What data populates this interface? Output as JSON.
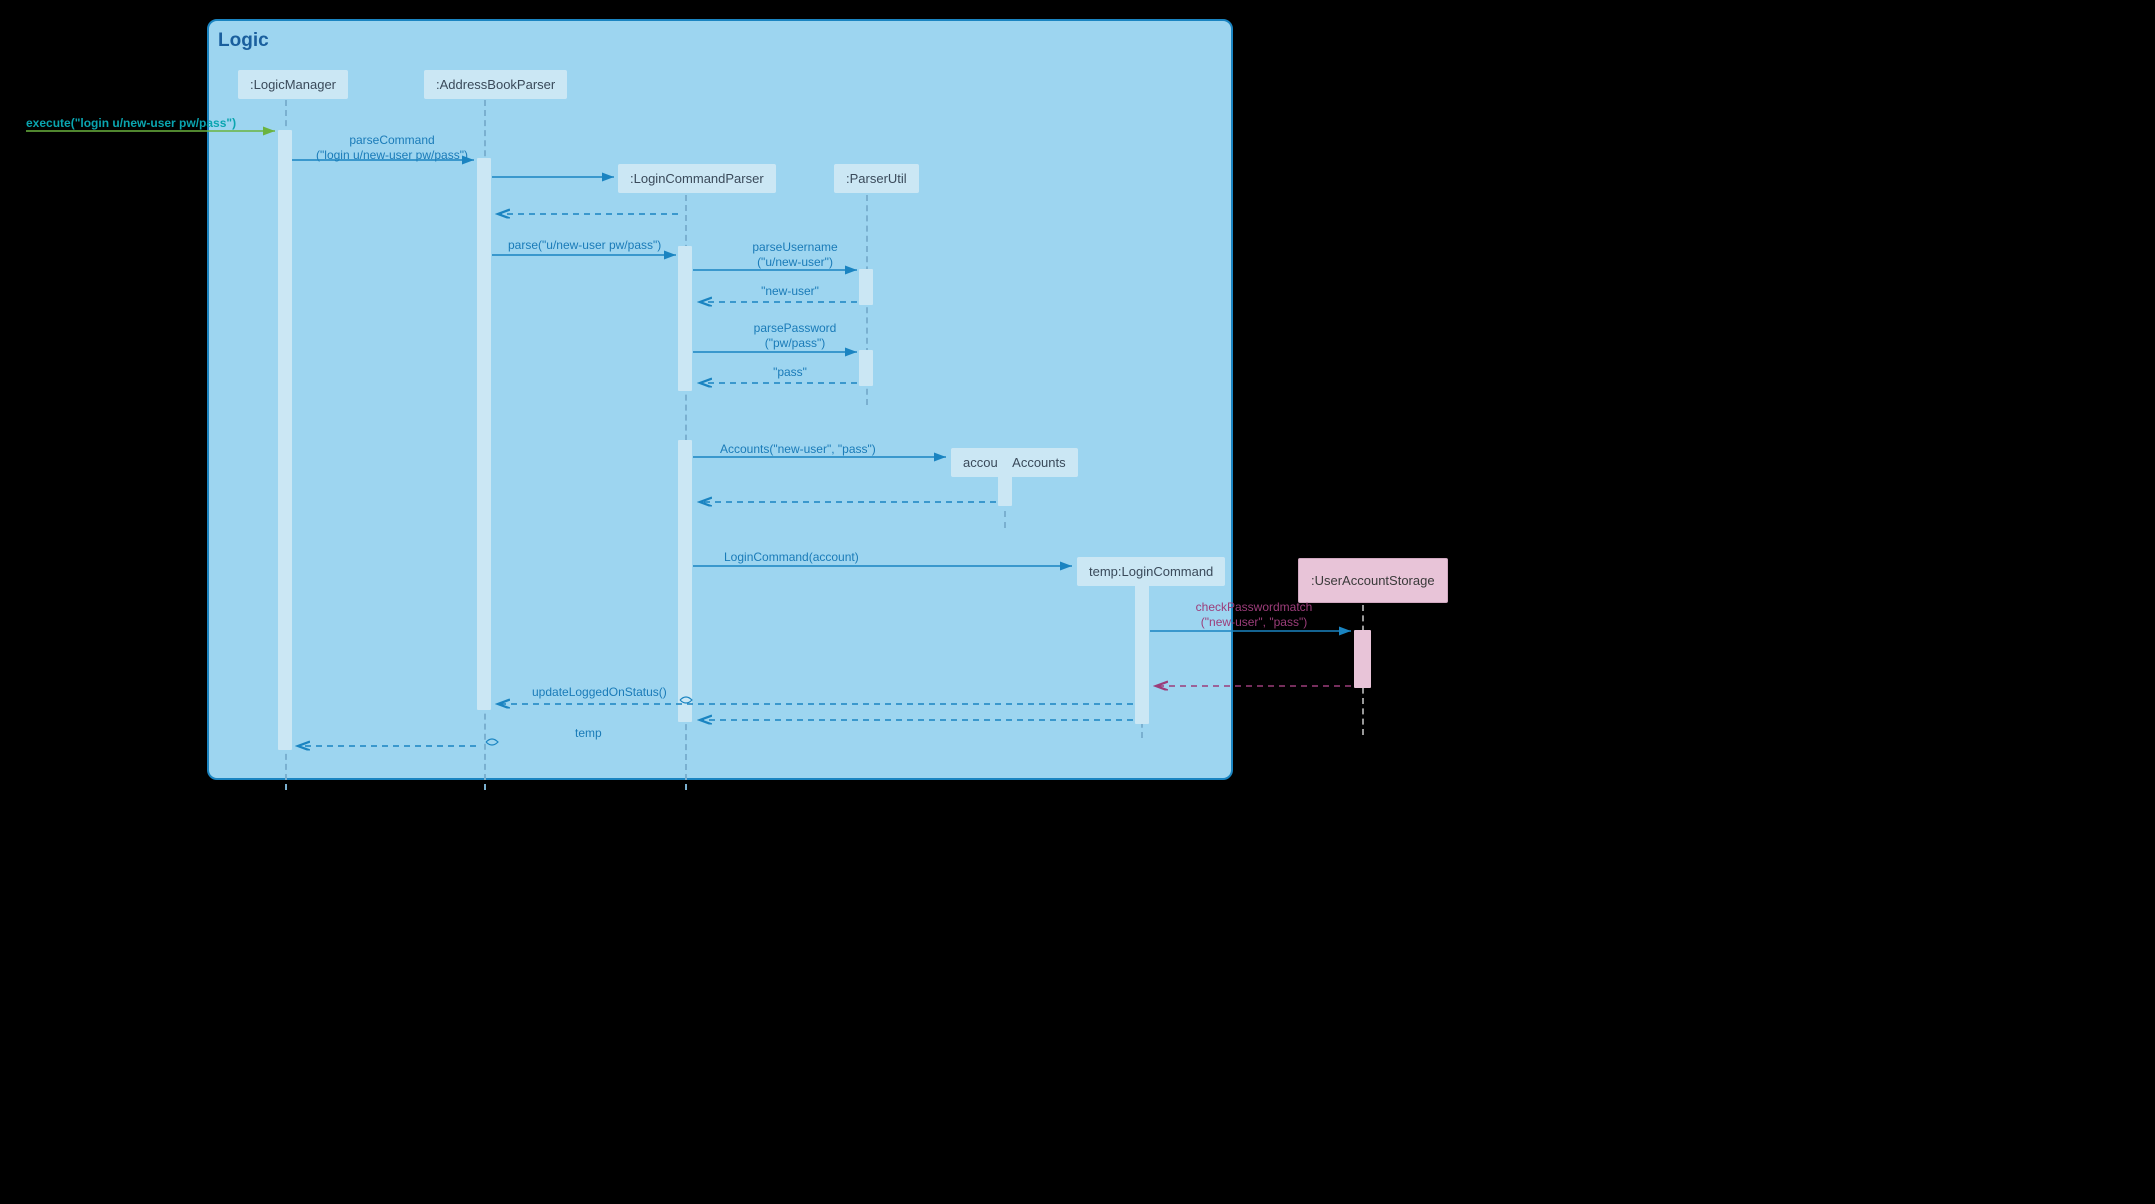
{
  "title": "Logic",
  "lifelines": {
    "logicManager": ":LogicManager",
    "addressBookParser": ":AddressBookParser",
    "loginCommandParser": ":LoginCommandParser",
    "parserUtil": ":ParserUtil",
    "accounts": "account:Accounts",
    "loginCommand": "temp:LoginCommand",
    "userAccountStorage": ":UserAccountStorage"
  },
  "messages": {
    "execute": "execute(\"login u/new-user pw/pass\")",
    "parseCommandLabel": "parseCommand",
    "parseCommandArg": "(\"login u/new-user pw/pass\")",
    "parse": "parse(\"u/new-user pw/pass\")",
    "parseUsername": "parseUsername",
    "parseUsernameArg": "(\"u/new-user\")",
    "newUserReturn": "\"new-user\"",
    "parsePassword": "parsePassword",
    "parsePasswordArg": "(\"pw/pass\")",
    "passReturn": "\"pass\"",
    "accountsNew": "Accounts(\"new-user\", \"pass\")",
    "loginCommandNew": "LoginCommand(account)",
    "checkPasswordMatch": "checkPasswordmatch",
    "checkPasswordMatchArg": "(\"new-user\", \"pass\")",
    "updateLoggedOnStatus": "updateLoggedOnStatus()",
    "temp": "temp"
  }
}
